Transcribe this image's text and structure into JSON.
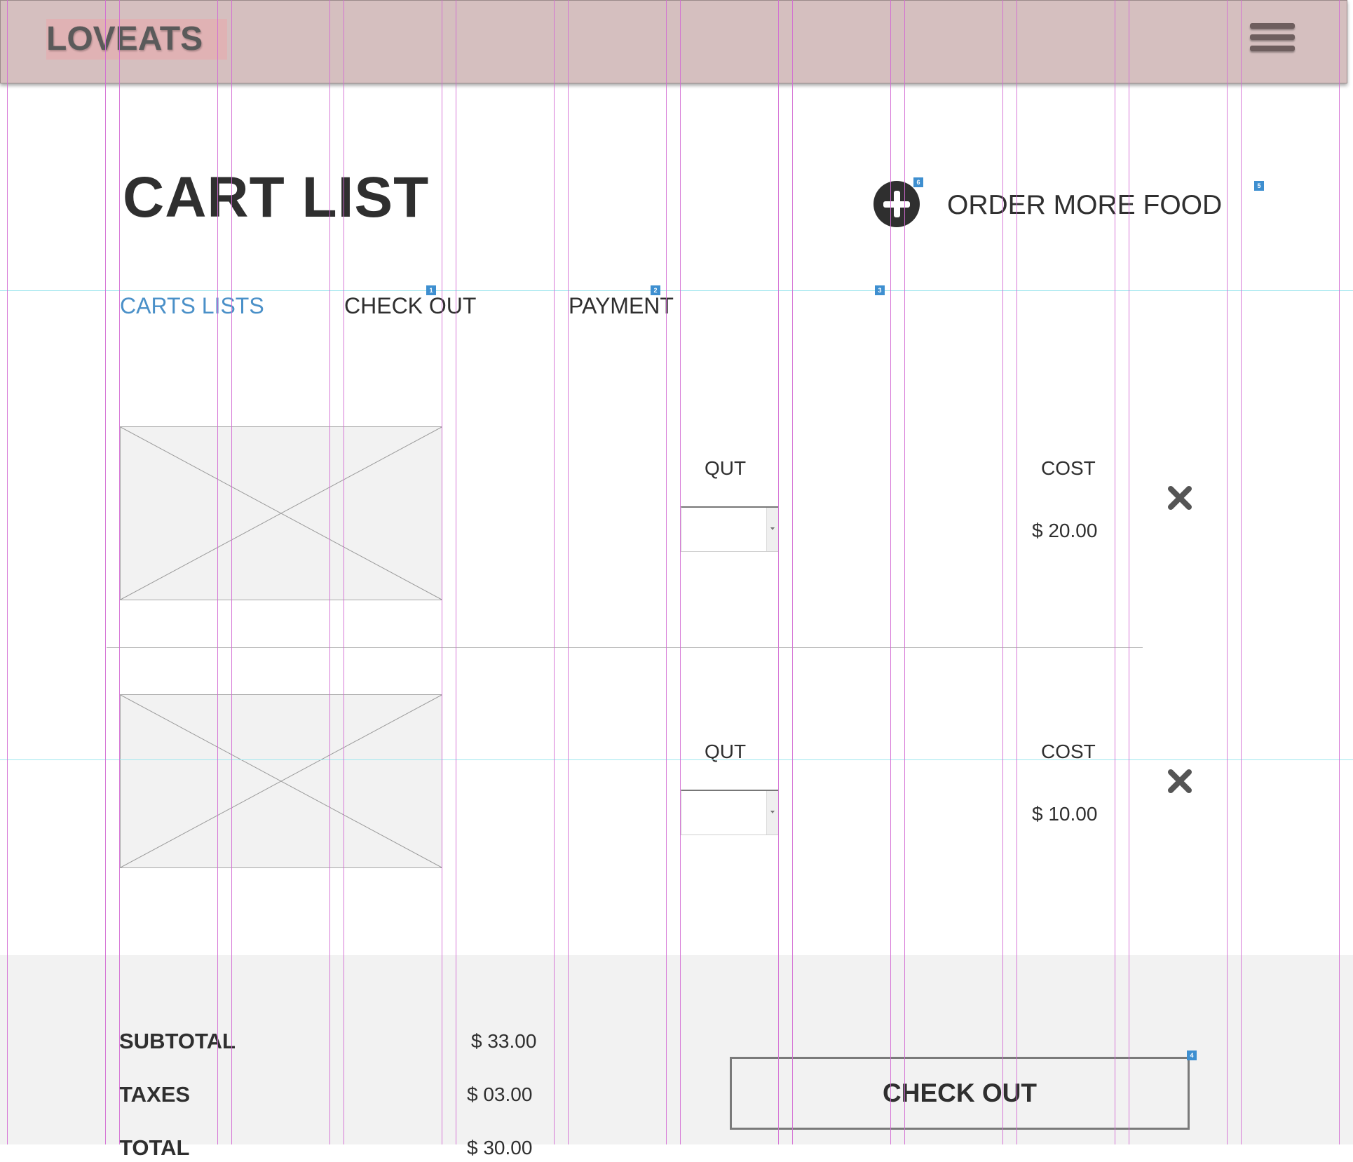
{
  "header": {
    "logo": "LOVEATS",
    "menu_icon": "hamburger-menu-icon"
  },
  "page": {
    "title": "CART LIST",
    "order_more_label": "ORDER MORE FOOD",
    "order_more_icon": "plus-circle-icon"
  },
  "steps": [
    {
      "label": "CARTS LISTS",
      "active": true
    },
    {
      "label": "CHECK OUT",
      "active": false
    },
    {
      "label": "PAYMENT",
      "active": false
    }
  ],
  "cart_items": [
    {
      "image": "image-placeholder",
      "qty_label": "QUT",
      "qty_value": "",
      "cost_label": "COST",
      "cost": "$ 20.00",
      "remove_icon": "close-icon"
    },
    {
      "image": "image-placeholder",
      "qty_label": "QUT",
      "qty_value": "",
      "cost_label": "COST",
      "cost": "$ 10.00",
      "remove_icon": "close-icon"
    }
  ],
  "summary": {
    "subtotal_label": "SUBTOTAL",
    "subtotal_value": "$ 33.00",
    "taxes_label": "TAXES",
    "taxes_value": "$ 03.00",
    "total_label": "TOTAL",
    "total_value": "$ 30.00",
    "checkout_label": "CHECK OUT"
  },
  "annotations": [
    "1",
    "2",
    "3",
    "4",
    "5",
    "6"
  ],
  "colors": {
    "header_bg": "#d5bfbf",
    "active_step": "#4a90c8",
    "guide_vertical": "#d36ad3",
    "guide_horizontal": "#9fe6ee",
    "marker": "#3e8fd0"
  }
}
